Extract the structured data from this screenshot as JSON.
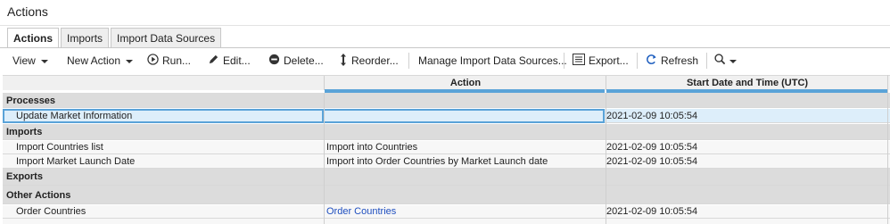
{
  "window": {
    "title": "Actions"
  },
  "tabs": [
    {
      "label": "Actions",
      "active": true
    },
    {
      "label": "Imports",
      "active": false
    },
    {
      "label": "Import Data Sources",
      "active": false
    }
  ],
  "toolbar": {
    "view": "View",
    "new_action": "New Action",
    "run": "Run...",
    "edit": "Edit...",
    "delete": "Delete...",
    "reorder": "Reorder...",
    "manage_sources": "Manage Import Data Sources...",
    "export": "Export...",
    "refresh": "Refresh",
    "search_icon": "search-icon"
  },
  "table": {
    "columns": [
      "",
      "Action",
      "Start Date and Time (UTC)"
    ],
    "groups": [
      {
        "name": "Processes",
        "rows": [
          {
            "name": "Update Market Information",
            "action": "",
            "start": "2021-02-09 10:05:54",
            "selected": true
          }
        ]
      },
      {
        "name": "Imports",
        "rows": [
          {
            "name": "Import Countries list",
            "action": "Import into Countries",
            "start": "2021-02-09 10:05:54"
          },
          {
            "name": "Import Market Launch Date",
            "action": "Import into Order Countries by Market Launch date",
            "start": "2021-02-09 10:05:54"
          }
        ]
      },
      {
        "name": "Exports",
        "rows": []
      },
      {
        "name": "Other Actions",
        "rows": [
          {
            "name": "Order Countries",
            "action": "Order Countries",
            "start": "2021-02-09 10:05:54",
            "action_is_link": true
          }
        ]
      }
    ]
  },
  "colors": {
    "accent": "#5aa3d8",
    "link": "#1f4fbf",
    "group_bg": "#dcdcdc",
    "selected_bg": "#ddeefa"
  }
}
